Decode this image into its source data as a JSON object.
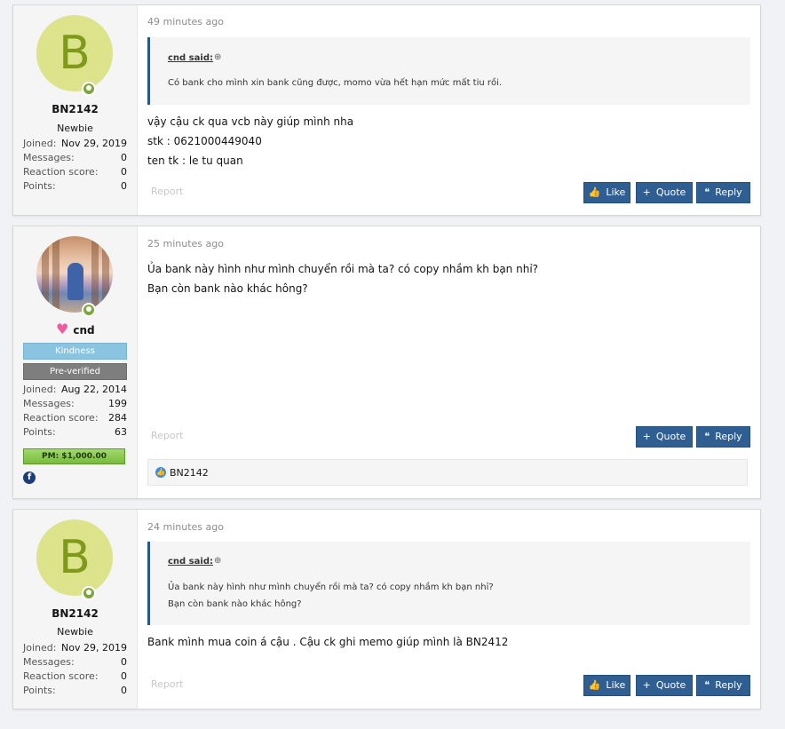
{
  "posts": [
    {
      "user": {
        "avatar_letter": "B",
        "name": "BN2142",
        "title": "Newbie",
        "stats": [
          {
            "label": "Joined:",
            "value": "Nov 29, 2019"
          },
          {
            "label": "Messages:",
            "value": "0"
          },
          {
            "label": "Reaction score:",
            "value": "0"
          },
          {
            "label": "Points:",
            "value": "0"
          }
        ]
      },
      "time": "49 minutes ago",
      "quote": {
        "author": "cnd said:",
        "lines": [
          "Có bank cho mình xin bank cũng được, momo vừa hết hạn mức mất tiu rồi."
        ]
      },
      "lines": [
        "vậy cậu ck qua vcb này giúp mình nha",
        "stk : 0621000449040",
        "ten tk : le tu quan"
      ],
      "report": "Report",
      "buttons": {
        "like": "Like",
        "quote": "Quote",
        "reply": "Reply"
      }
    },
    {
      "user": {
        "name": "cnd",
        "banners": [
          "Kindness",
          "Pre-verified"
        ],
        "stats": [
          {
            "label": "Joined:",
            "value": "Aug 22, 2014"
          },
          {
            "label": "Messages:",
            "value": "199"
          },
          {
            "label": "Reaction score:",
            "value": "284"
          },
          {
            "label": "Points:",
            "value": "63"
          }
        ],
        "pm": "PM: $1,000.00",
        "social": "f"
      },
      "time": "25 minutes ago",
      "lines": [
        "Ủa bank này hình như mình chuyển rồi mà ta? có copy nhầm kh bạn nhỉ?",
        "Bạn còn bank nào khác hông?"
      ],
      "report": "Report",
      "buttons": {
        "quote": "Quote",
        "reply": "Reply"
      },
      "reactions": {
        "users": "BN2142"
      }
    },
    {
      "user": {
        "avatar_letter": "B",
        "name": "BN2142",
        "title": "Newbie",
        "stats": [
          {
            "label": "Joined:",
            "value": "Nov 29, 2019"
          },
          {
            "label": "Messages:",
            "value": "0"
          },
          {
            "label": "Reaction score:",
            "value": "0"
          },
          {
            "label": "Points:",
            "value": "0"
          }
        ]
      },
      "time": "24 minutes ago",
      "quote": {
        "author": "cnd said:",
        "lines": [
          "Ủa bank này hình như mình chuyển rồi mà ta? có copy nhầm kh bạn nhỉ?",
          "Bạn còn bank nào khác hông?"
        ]
      },
      "lines": [
        "Bank mình mua coin á cậu . Cậu ck ghi memo giúp mình là BN2412"
      ],
      "report": "Report",
      "buttons": {
        "like": "Like",
        "quote": "Quote",
        "reply": "Reply"
      }
    }
  ],
  "colors": {
    "accent": "#2f5f92",
    "online": "#7aa83d",
    "avatar_bg": "#dde38b"
  }
}
